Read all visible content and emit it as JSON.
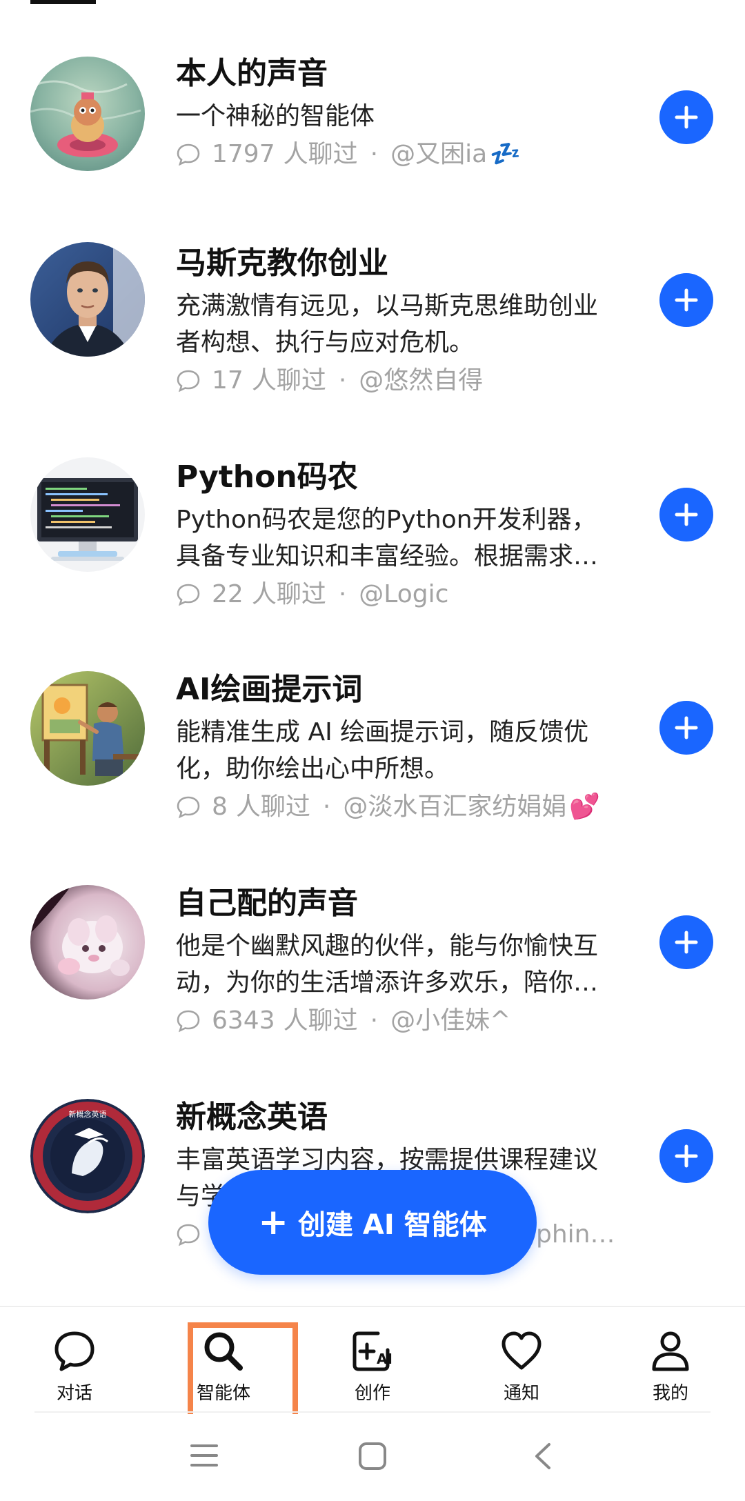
{
  "agents": [
    {
      "title": "本人的声音",
      "description": "一个神秘的智能体",
      "chat_count": "1797",
      "chat_suffix": "人聊过",
      "author": "@又困ia",
      "author_emoji": "💤"
    },
    {
      "title": "马斯克教你创业",
      "description": "充满激情有远见，以马斯克思维助创业者构想、执行与应对危机。",
      "chat_count": "17",
      "chat_suffix": "人聊过",
      "author": "@悠然自得",
      "author_emoji": ""
    },
    {
      "title": "Python码农",
      "description": "Python码农是您的Python开发利器，具备专业知识和丰富经验。根据需求提供代码编写与调试帮助。",
      "chat_count": "22",
      "chat_suffix": "人聊过",
      "author": "@Logic",
      "author_emoji": ""
    },
    {
      "title": "AI绘画提示词",
      "description": "能精准生成 AI 绘画提示词，随反馈优化，助你绘出心中所想。",
      "chat_count": "8",
      "chat_suffix": "人聊过",
      "author": "@淡水百汇家纺娟娟",
      "author_emoji": "💕"
    },
    {
      "title": "自己配的声音",
      "description": "他是个幽默风趣的伙伴，能与你愉快互动，为你的生活增添许多欢乐，陪你度过每一天。",
      "chat_count": "6343",
      "chat_suffix": "人聊过",
      "author": "@小佳妹^",
      "author_emoji": ""
    },
    {
      "title": "新概念英语",
      "description": "丰富英语学习内容，按需提供课程建议与学习指导。",
      "chat_count": "",
      "chat_suffix": "",
      "author": "",
      "author_emoji": ""
    }
  ],
  "agent6_author_partial": "phin…",
  "fab": {
    "label": "创建 AI 智能体"
  },
  "bottom_nav": {
    "items": [
      {
        "label": "对话",
        "icon": "chat-bubble-icon"
      },
      {
        "label": "智能体",
        "icon": "search-icon"
      },
      {
        "label": "创作",
        "icon": "create-ai-icon"
      },
      {
        "label": "通知",
        "icon": "heart-icon"
      },
      {
        "label": "我的",
        "icon": "person-icon"
      }
    ],
    "active_index": 1
  },
  "system_nav": {
    "icons": [
      "menu-icon",
      "home-icon",
      "back-icon"
    ]
  },
  "colors": {
    "accent": "#1a66ff",
    "highlight_box": "#f5844a",
    "meta_text": "#a3a3a3"
  }
}
